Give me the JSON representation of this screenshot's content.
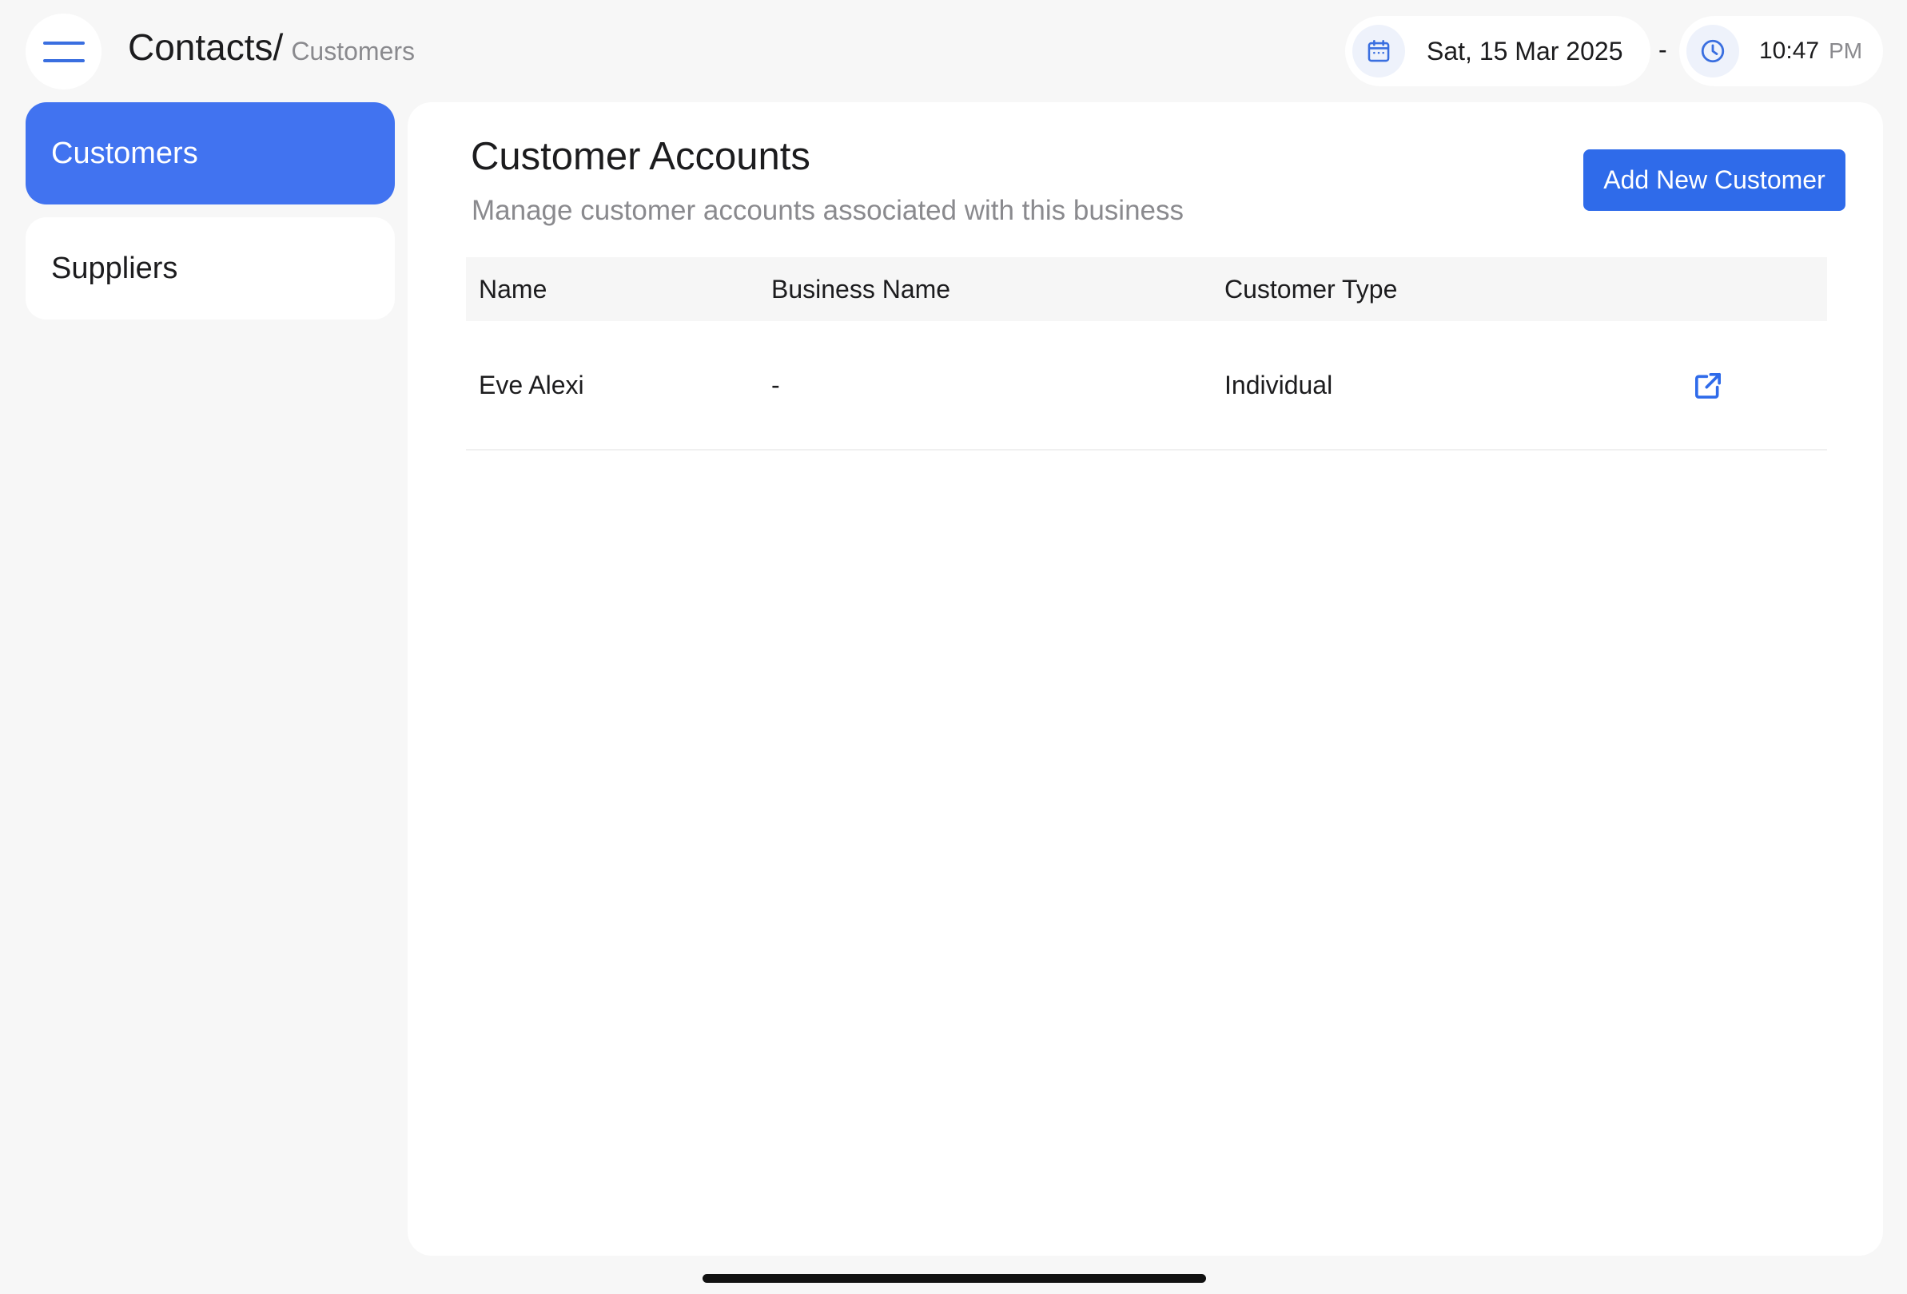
{
  "header": {
    "breadcrumb_root": "Contacts/",
    "breadcrumb_current": "Customers",
    "date": "Sat, 15 Mar 2025",
    "separator": "-",
    "time": "10:47",
    "ampm": "PM"
  },
  "icons": {
    "menu": "hamburger-menu-icon",
    "calendar": "calendar-icon",
    "clock": "clock-icon",
    "open": "external-link-icon"
  },
  "colors": {
    "accent": "#4173f0",
    "button": "#2f6bea",
    "background": "#f7f7f7"
  },
  "sidebar": {
    "items": [
      {
        "label": "Customers",
        "active": true
      },
      {
        "label": "Suppliers",
        "active": false
      }
    ]
  },
  "main": {
    "title": "Customer Accounts",
    "subtitle": "Manage customer accounts associated with this business",
    "add_button_label": "Add New Customer",
    "table": {
      "columns": [
        "Name",
        "Business Name",
        "Customer Type"
      ],
      "rows": [
        {
          "name": "Eve Alexi",
          "business_name": "-",
          "customer_type": "Individual"
        }
      ]
    }
  }
}
